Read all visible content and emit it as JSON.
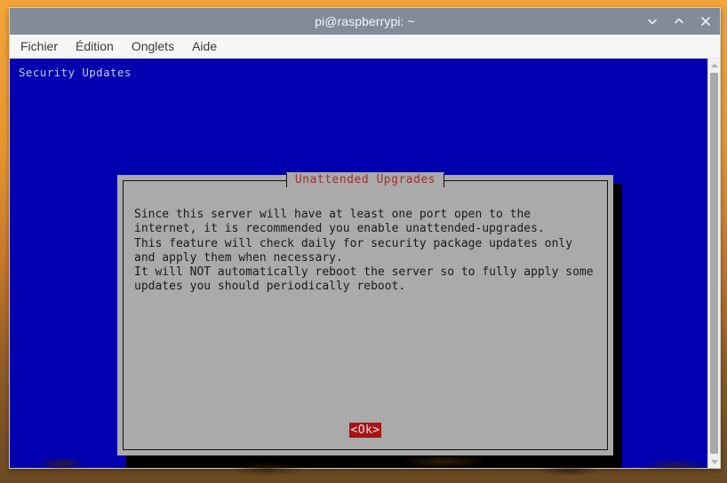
{
  "window": {
    "title": "pi@raspberrypi: ~",
    "controls": [
      {
        "name": "minimize",
        "icon": "chevron-down-icon",
        "glyph": "⌄"
      },
      {
        "name": "maximize",
        "icon": "chevron-up-icon",
        "glyph": "⌃"
      },
      {
        "name": "close",
        "icon": "close-icon",
        "glyph": "✕"
      }
    ]
  },
  "menubar": {
    "items": [
      {
        "label": "Fichier"
      },
      {
        "label": "Édition"
      },
      {
        "label": "Onglets"
      },
      {
        "label": "Aide"
      }
    ]
  },
  "terminal": {
    "backtitle": "Security Updates",
    "background_color": "#0000b0",
    "backtitle_color": "#c8c8d8"
  },
  "dialog": {
    "title": "Unattended Upgrades",
    "title_color": "#a03030",
    "background_color": "#aaaaaa",
    "body": "Since this server will have at least one port open to the\ninternet, it is recommended you enable unattended-upgrades.\nThis feature will check daily for security package updates only\nand apply them when necessary.\nIt will NOT automatically reboot the server so to fully apply some\nupdates you should periodically reboot.",
    "buttons": [
      {
        "label": "<Ok>",
        "selected": true,
        "background_color": "#a81414",
        "text_color": "#e6e6e6"
      }
    ]
  },
  "scrollbar": {
    "up_arrow": "▲",
    "down_arrow": "▼",
    "thumb_color": "#a9a9a9",
    "track_color": "#f0f0f0"
  }
}
